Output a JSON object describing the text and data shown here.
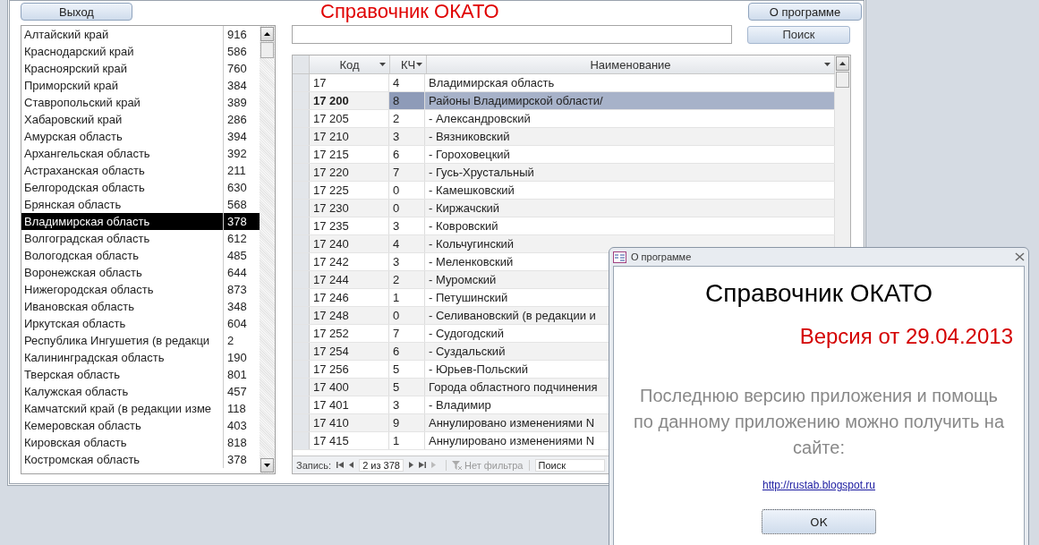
{
  "main": {
    "exit_button": "Выход",
    "title": "Справочник ОКАТО",
    "about_button": "О программе"
  },
  "regions": {
    "rows": [
      {
        "name": "Алтайский край",
        "count": "916",
        "selected": false
      },
      {
        "name": "Краснодарский край",
        "count": "586",
        "selected": false
      },
      {
        "name": "Красноярский край",
        "count": "760",
        "selected": false
      },
      {
        "name": "Приморский край",
        "count": "384",
        "selected": false
      },
      {
        "name": "Ставропольский край",
        "count": "389",
        "selected": false
      },
      {
        "name": "Хабаровский край",
        "count": "286",
        "selected": false
      },
      {
        "name": "Амурская область",
        "count": "394",
        "selected": false
      },
      {
        "name": "Архангельская область",
        "count": "392",
        "selected": false
      },
      {
        "name": "Астраханская область",
        "count": "211",
        "selected": false
      },
      {
        "name": "Белгородская область",
        "count": "630",
        "selected": false
      },
      {
        "name": "Брянская область",
        "count": "568",
        "selected": false
      },
      {
        "name": "Владимирская область",
        "count": "378",
        "selected": true
      },
      {
        "name": "Волгоградская область",
        "count": "612",
        "selected": false
      },
      {
        "name": "Вологодская область",
        "count": "485",
        "selected": false
      },
      {
        "name": "Воронежская область",
        "count": "644",
        "selected": false
      },
      {
        "name": "Нижегородская область",
        "count": "873",
        "selected": false
      },
      {
        "name": "Ивановская область",
        "count": "348",
        "selected": false
      },
      {
        "name": "Иркутская область",
        "count": "604",
        "selected": false
      },
      {
        "name": "Республика Ингушетия (в редакци",
        "count": "2",
        "selected": false
      },
      {
        "name": "Калининградская область",
        "count": "190",
        "selected": false
      },
      {
        "name": "Тверская область",
        "count": "801",
        "selected": false
      },
      {
        "name": "Калужская область",
        "count": "457",
        "selected": false
      },
      {
        "name": "Камчатский край (в редакции изме",
        "count": "118",
        "selected": false
      },
      {
        "name": "Кемеровская область",
        "count": "403",
        "selected": false
      },
      {
        "name": "Кировская область",
        "count": "818",
        "selected": false
      },
      {
        "name": "Костромская область",
        "count": "378",
        "selected": false
      }
    ]
  },
  "search": {
    "button": "Поиск"
  },
  "table": {
    "columns": [
      {
        "label": "Код"
      },
      {
        "label": "КЧ"
      },
      {
        "label": "Наименование"
      }
    ],
    "rows": [
      {
        "code": "17",
        "check": "4",
        "name": "Владимирская область",
        "selected": false
      },
      {
        "code": "17 200",
        "check": "8",
        "name": "Районы Владимирской области/",
        "selected": true
      },
      {
        "code": "17 205",
        "check": "2",
        "name": "- Александровский",
        "selected": false
      },
      {
        "code": "17 210",
        "check": "3",
        "name": "- Вязниковский",
        "selected": false
      },
      {
        "code": "17 215",
        "check": "6",
        "name": "- Гороховецкий",
        "selected": false
      },
      {
        "code": "17 220",
        "check": "7",
        "name": "- Гусь-Хрустальный",
        "selected": false
      },
      {
        "code": "17 225",
        "check": "0",
        "name": "- Камешковский",
        "selected": false
      },
      {
        "code": "17 230",
        "check": "0",
        "name": "- Киржачский",
        "selected": false
      },
      {
        "code": "17 235",
        "check": "3",
        "name": "- Ковровский",
        "selected": false
      },
      {
        "code": "17 240",
        "check": "4",
        "name": "- Кольчугинский",
        "selected": false
      },
      {
        "code": "17 242",
        "check": "3",
        "name": "- Меленковский",
        "selected": false
      },
      {
        "code": "17 244",
        "check": "2",
        "name": "- Муромский",
        "selected": false
      },
      {
        "code": "17 246",
        "check": "1",
        "name": "- Петушинский",
        "selected": false
      },
      {
        "code": "17 248",
        "check": "0",
        "name": "- Селивановский (в редакции и",
        "selected": false
      },
      {
        "code": "17 252",
        "check": "7",
        "name": "- Судогодский",
        "selected": false
      },
      {
        "code": "17 254",
        "check": "6",
        "name": "- Суздальский",
        "selected": false
      },
      {
        "code": "17 256",
        "check": "5",
        "name": "- Юрьев-Польский",
        "selected": false
      },
      {
        "code": "17 400",
        "check": "5",
        "name": "Города областного подчинения",
        "selected": false
      },
      {
        "code": "17 401",
        "check": "3",
        "name": "- Владимир",
        "selected": false
      },
      {
        "code": "17 410",
        "check": "9",
        "name": "Аннулировано изменениями N",
        "selected": false
      },
      {
        "code": "17 415",
        "check": "1",
        "name": "Аннулировано изменениями N",
        "selected": false
      }
    ]
  },
  "navigator": {
    "label": "Запись:",
    "position": "2 из 378",
    "filter": "Нет фильтра",
    "search": "Поиск"
  },
  "dialog": {
    "title": "О программе",
    "heading": "Справочник ОКАТО",
    "version": "Версия от 29.04.2013",
    "message": "Последнюю версию приложения и помощь по данному приложению можно получить на сайте:",
    "link": "http://rustab.blogspot.ru",
    "ok_button": "ОК"
  }
}
